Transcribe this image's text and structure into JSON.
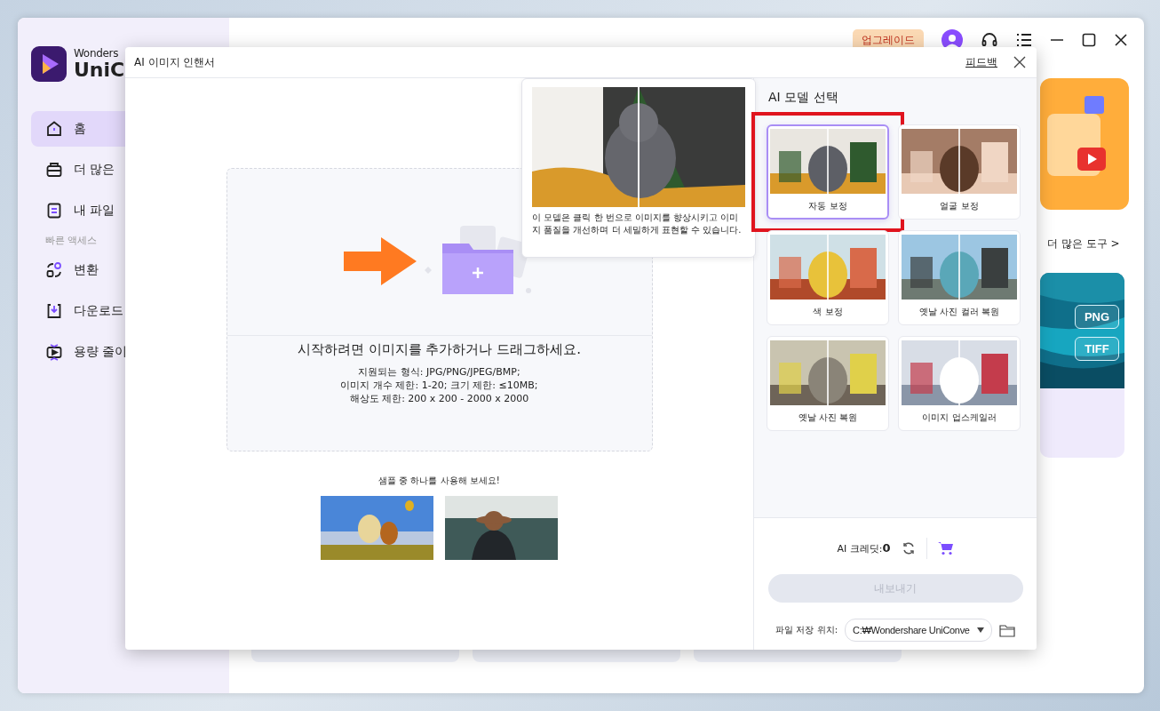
{
  "app": {
    "logo_lines": [
      "Wonders",
      "UniC"
    ],
    "sidebar": {
      "items": [
        {
          "label": "홈",
          "selected": true
        },
        {
          "label": "더 많은",
          "selected": false
        },
        {
          "label": "내 파일",
          "selected": false
        }
      ],
      "section_label": "빠른 액세스",
      "quick_items": [
        {
          "label": "변환",
          "selected": false
        },
        {
          "label": "다운로드",
          "selected": false
        },
        {
          "label": "용량 줄이",
          "selected": false
        }
      ]
    },
    "header": {
      "upgrade": "업그레이드"
    },
    "more_tools": "더 많은 도구 >",
    "format_buttons": [
      "PNG",
      "TIFF"
    ]
  },
  "dialog": {
    "title": "AI 이미지 인핸서",
    "feedback": "피드백",
    "drop_zone": {
      "prompt": "시작하려면 이미지를 추가하거나 드래그하세요.",
      "details": [
        "지원되는 형식: JPG/PNG/JPEG/BMP;",
        "이미지 개수 제한: 1-20; 크기 제한: ≤10MB;",
        "해상도 제한: 200 x 200 - 2000 x 2000"
      ]
    },
    "samples_label": "샘플 중 하나를 사용해 보세요!",
    "tooltip": {
      "text": "이 모델은 클릭 한 번으로 이미지를 향상시키고 이미지 품질을 개선하며 더 세밀하게 표현할 수 있습니다."
    },
    "model_heading": "AI 모델 선택",
    "models": [
      {
        "label": "자동 보정",
        "selected": true,
        "highlighted": true
      },
      {
        "label": "얼굴 보정",
        "selected": false,
        "highlighted": false
      },
      {
        "label": "색 보정",
        "selected": false,
        "highlighted": false
      },
      {
        "label": "옛날 사진 컬러 복원",
        "selected": false,
        "highlighted": false
      },
      {
        "label": "옛날 사진 복원",
        "selected": false,
        "highlighted": false
      },
      {
        "label": "이미지 업스케일러",
        "selected": false,
        "highlighted": false
      }
    ],
    "credits": {
      "label": "AI 크레딧:",
      "value": "0"
    },
    "export": {
      "label": "내보내기",
      "disabled": true
    },
    "save_location": {
      "label": "파일 저장 위치:",
      "value": "C:₩Wondershare UniConve"
    }
  }
}
